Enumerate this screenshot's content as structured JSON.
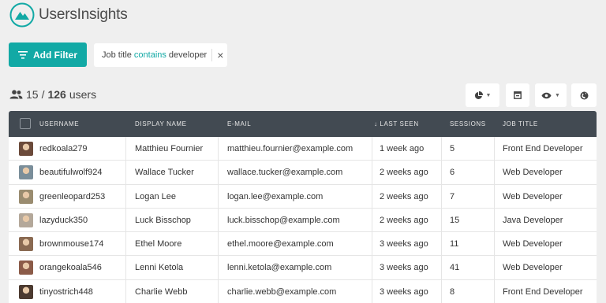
{
  "app": {
    "name": "UsersInsights"
  },
  "toolbar": {
    "add_filter_label": "Add Filter",
    "filter": {
      "field": "Job title",
      "operator": "contains",
      "value": "developer",
      "remove": "×"
    }
  },
  "summary": {
    "shown": "15",
    "sep": "/",
    "total": "126",
    "unit": "users"
  },
  "table": {
    "headers": {
      "username": "Username",
      "display_name": "Display Name",
      "email": "E-mail",
      "last_seen": "↓ Last Seen",
      "sessions": "Sessions",
      "job_title": "Job Title"
    },
    "rows": [
      {
        "username": "redkoala279",
        "display_name": "Matthieu Fournier",
        "email": "matthieu.fournier@example.com",
        "last_seen": "1 week ago",
        "sessions": "5",
        "job_title": "Front End Developer",
        "avatar_color": "#6b4a3a"
      },
      {
        "username": "beautifulwolf924",
        "display_name": "Wallace Tucker",
        "email": "wallace.tucker@example.com",
        "last_seen": "2 weeks ago",
        "sessions": "6",
        "job_title": "Web Developer",
        "avatar_color": "#7a8e9a"
      },
      {
        "username": "greenleopard253",
        "display_name": "Logan Lee",
        "email": "logan.lee@example.com",
        "last_seen": "2 weeks ago",
        "sessions": "7",
        "job_title": "Web Developer",
        "avatar_color": "#9a8c70"
      },
      {
        "username": "lazyduck350",
        "display_name": "Luck Bisschop",
        "email": "luck.bisschop@example.com",
        "last_seen": "2 weeks ago",
        "sessions": "15",
        "job_title": "Java Developer",
        "avatar_color": "#b4a89a"
      },
      {
        "username": "brownmouse174",
        "display_name": "Ethel Moore",
        "email": "ethel.moore@example.com",
        "last_seen": "3 weeks ago",
        "sessions": "11",
        "job_title": "Web Developer",
        "avatar_color": "#8a6a52"
      },
      {
        "username": "orangekoala546",
        "display_name": "Lenni Ketola",
        "email": "lenni.ketola@example.com",
        "last_seen": "3 weeks ago",
        "sessions": "41",
        "job_title": "Web Developer",
        "avatar_color": "#8b5b48"
      },
      {
        "username": "tinyostrich448",
        "display_name": "Charlie Webb",
        "email": "charlie.webb@example.com",
        "last_seen": "3 weeks ago",
        "sessions": "8",
        "job_title": "Front End Developer",
        "avatar_color": "#4c3a30"
      }
    ]
  },
  "colors": {
    "accent": "#12a9a5",
    "header_bg": "#424a52",
    "page_bg": "#efefef"
  },
  "icons": {
    "logo": "mountain-logo-icon",
    "filter": "filter-lines-icon",
    "users": "users-group-icon",
    "segment": "pie-chart-icon",
    "export": "export-box-icon",
    "columns": "eye-icon",
    "map": "globe-icon"
  }
}
